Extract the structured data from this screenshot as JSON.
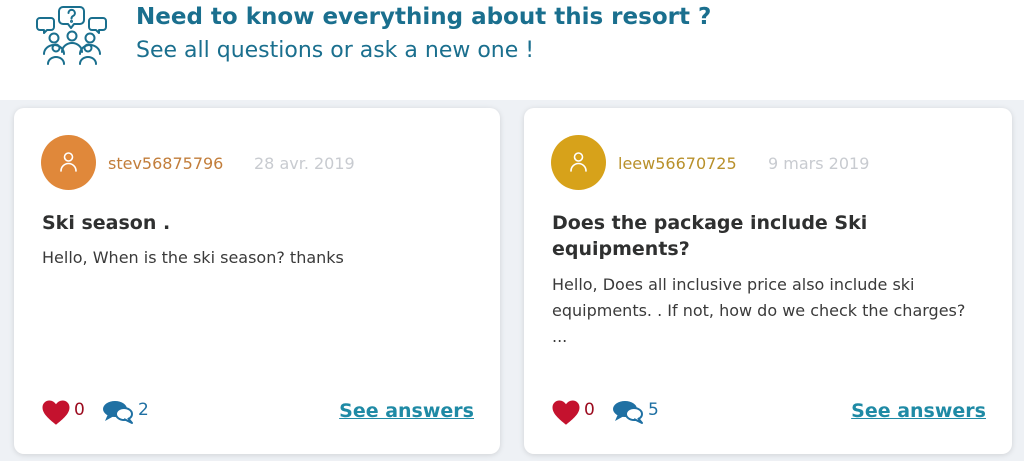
{
  "header": {
    "title": "Need to know everything about this resort ?",
    "subtitle": "See all questions or ask a new one !",
    "icon": "community-questions-icon"
  },
  "colors": {
    "brand": "#1a6f8e",
    "link": "#1f8aa5",
    "like": "#c4122e",
    "comment": "#1f70a3",
    "date": "#c8cbd0"
  },
  "questions": [
    {
      "username": "stev56875796",
      "date": "28 avr. 2019",
      "avatar_color": "#e0883a",
      "username_color": "#c27d3a",
      "title": "Ski season .",
      "body": "Hello, When is the ski season? thanks",
      "likes": "0",
      "comments": "2",
      "link_label": "See answers"
    },
    {
      "username": "leew56670725",
      "date": "9 mars 2019",
      "avatar_color": "#d7a21a",
      "username_color": "#b8902a",
      "title": "Does the package include Ski equipments?",
      "body": "Hello, Does all inclusive price also include ski equipments. . If not, how do we check the charges? ...",
      "likes": "0",
      "comments": "5",
      "link_label": "See answers"
    }
  ]
}
